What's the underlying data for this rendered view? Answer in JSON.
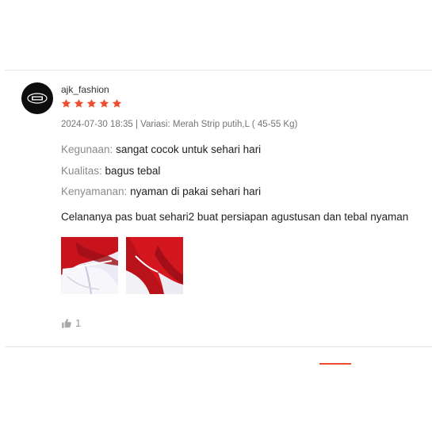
{
  "review": {
    "username": "ajk_fashion",
    "avatar_logo_text": "AJK fashion",
    "rating": 5,
    "rating_max": 5,
    "meta": "2024-07-30 18:35 | Variasi: Merah Strip putih,L ( 45-55 Kg)",
    "attributes": [
      {
        "label": "Kegunaan:",
        "value": "sangat cocok untuk sehari hari"
      },
      {
        "label": "Kualitas:",
        "value": "bagus tebal"
      },
      {
        "label": "Kenyamanan:",
        "value": "nyaman di pakai sehari hari"
      }
    ],
    "comment": "Celananya pas buat sehari2 buat persiapan agustusan dan tebal nyaman",
    "likes": "1"
  },
  "colors": {
    "star": "#ee4d2d",
    "accent": "#ee4d2d",
    "muted": "#757575"
  },
  "icons": {
    "star": "star-icon",
    "like": "thumbs-up-icon"
  }
}
